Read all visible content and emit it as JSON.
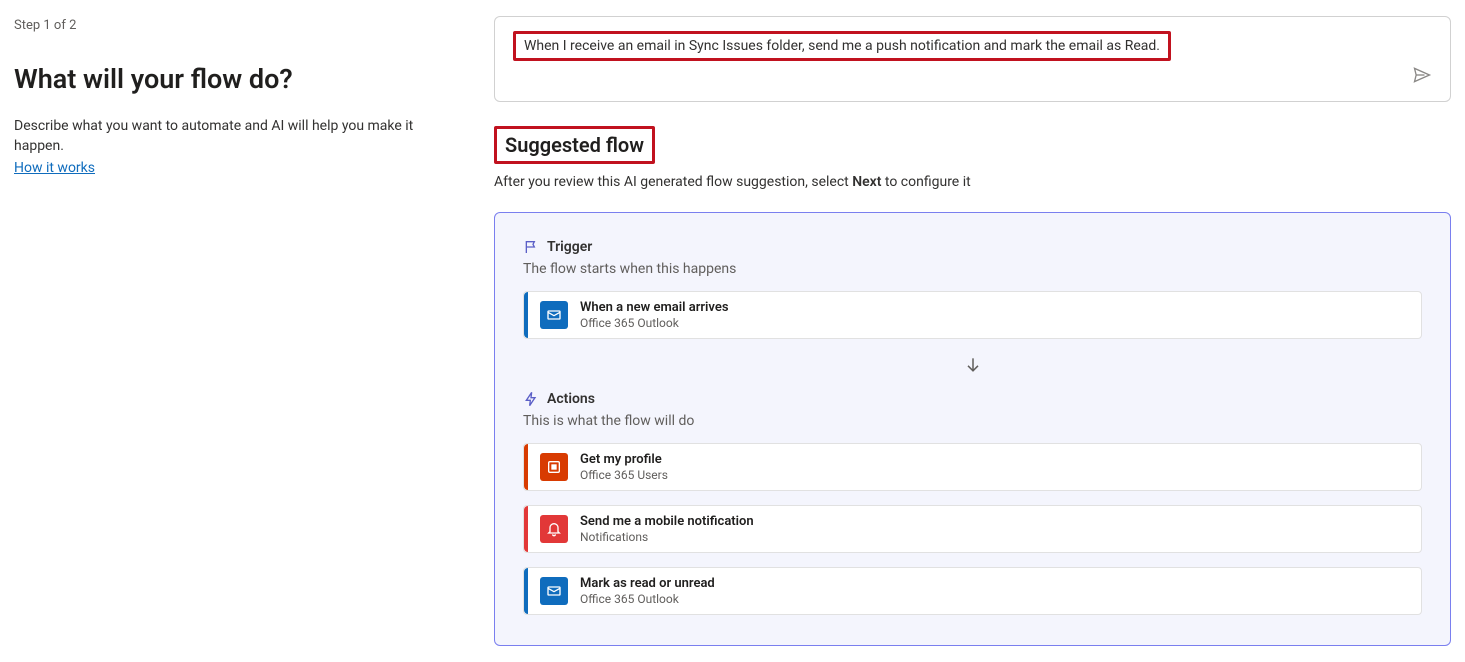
{
  "left": {
    "step": "Step 1 of 2",
    "headline": "What will your flow do?",
    "description": "Describe what you want to automate and AI will help you make it happen.",
    "how_link": "How it works"
  },
  "prompt": {
    "text": "When I receive an email in Sync Issues folder, send me a push notification and mark the email as Read."
  },
  "suggested": {
    "heading": "Suggested flow",
    "review_prefix": "After you review this AI generated flow suggestion, select ",
    "review_bold": "Next",
    "review_suffix": " to configure it"
  },
  "trigger": {
    "header": "Trigger",
    "sub": "The flow starts when this happens",
    "card": {
      "title": "When a new email arrives",
      "sub": "Office 365 Outlook",
      "accent": "#0f6cbd",
      "icon_bg": "#0f6cbd"
    }
  },
  "actions": {
    "header": "Actions",
    "sub": "This is what the flow will do",
    "items": [
      {
        "title": "Get my profile",
        "sub": "Office 365 Users",
        "accent": "#d83b01",
        "icon_bg": "#d83b01",
        "icon": "office"
      },
      {
        "title": "Send me a mobile notification",
        "sub": "Notifications",
        "accent": "#e23838",
        "icon_bg": "#e23838",
        "icon": "bell"
      },
      {
        "title": "Mark as read or unread",
        "sub": "Office 365 Outlook",
        "accent": "#0f6cbd",
        "icon_bg": "#0f6cbd",
        "icon": "outlook"
      }
    ]
  }
}
